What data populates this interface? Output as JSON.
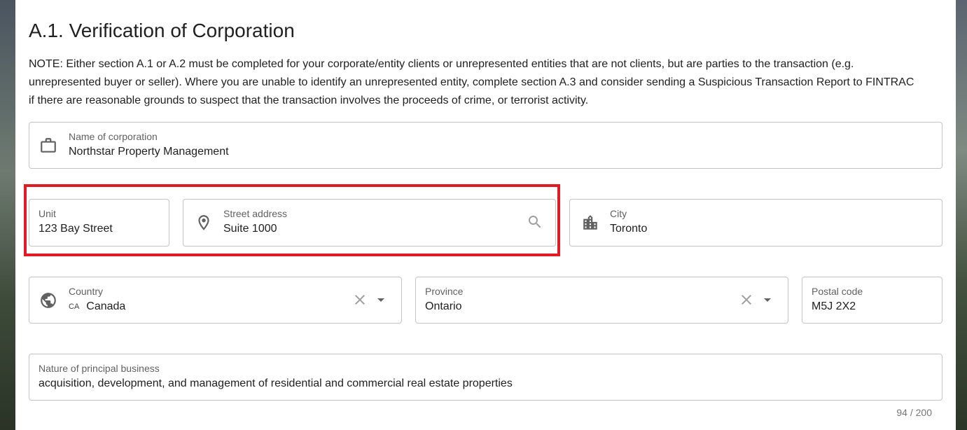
{
  "section": {
    "title": "A.1. Verification of Corporation",
    "note": "NOTE: Either section A.1 or A.2 must be completed for your corporate/entity clients or unrepresented entities that are not clients, but are parties to the transaction (e.g. unrepresented buyer or seller). Where you are unable to identify an unrepresented entity, complete section A.3 and consider sending a Suspicious Transaction Report to FINTRAC if there are reasonable grounds to suspect that the transaction involves the proceeds of crime, or terrorist activity."
  },
  "fields": {
    "corporation_name": {
      "label": "Name of corporation",
      "value": "Northstar Property Management",
      "icon": "briefcase-icon"
    },
    "unit": {
      "label": "Unit",
      "value": "123 Bay Street"
    },
    "street_address": {
      "label": "Street address",
      "value": "Suite 1000",
      "icon": "location-pin-icon",
      "trailing_icon": "search-icon"
    },
    "city": {
      "label": "City",
      "value": "Toronto",
      "icon": "city-buildings-icon"
    },
    "country": {
      "label": "Country",
      "code": "CA",
      "value": "Canada",
      "icon": "globe-icon"
    },
    "province": {
      "label": "Province",
      "value": "Ontario"
    },
    "postal_code": {
      "label": "Postal code",
      "value": "M5J 2X2"
    },
    "nature_of_business": {
      "label": "Nature of principal business",
      "value": "acquisition, development, and management of residential and commercial real estate properties",
      "counter": "94 / 200"
    }
  },
  "colors": {
    "highlight": "#e01b24",
    "border": "#c4c4c4",
    "label": "#616161"
  }
}
